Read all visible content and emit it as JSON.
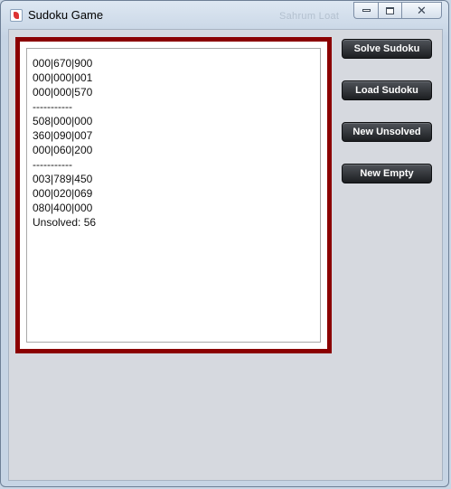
{
  "window": {
    "title": "Sudoku Game",
    "ghost_text": "Sahrum Loat"
  },
  "output": {
    "lines": [
      "000|670|900",
      "000|000|001",
      "000|000|570",
      "-----------",
      "508|000|000",
      "360|090|007",
      "000|060|200",
      "-----------",
      "003|789|450",
      "000|020|069",
      "080|400|000",
      "Unsolved: 56"
    ]
  },
  "buttons": {
    "solve": "Solve Sudoku",
    "load": "Load Sudoku",
    "new_unsolved": "New Unsolved",
    "new_empty": "New Empty"
  },
  "colors": {
    "frame": "#8b0000",
    "button": "#2a2d31"
  }
}
